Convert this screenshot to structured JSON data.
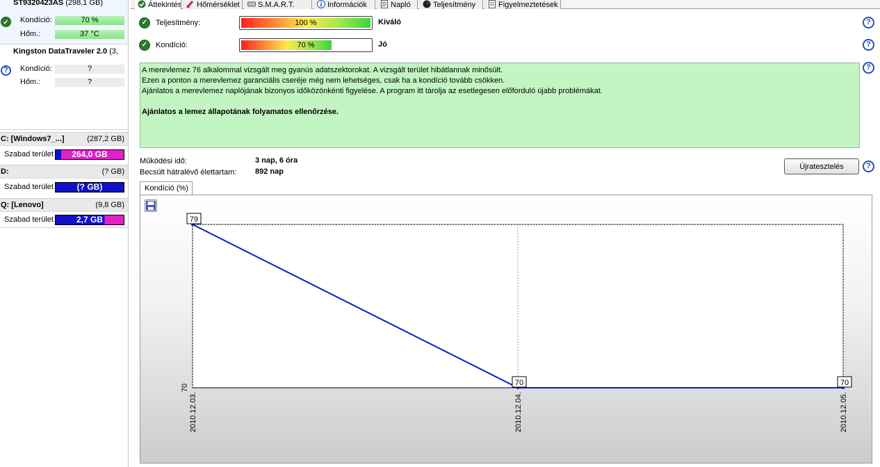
{
  "sidebar": {
    "disk1": {
      "name": "ST9320423AS",
      "size": "(298,1 GB)",
      "health_label": "Kondíció:",
      "health_value": "70 %",
      "temp_label": "Hőm.:",
      "temp_value": "37 °C"
    },
    "disk2": {
      "name": "Kingston DataTraveler 2.0",
      "size": "(3,",
      "health_label": "Kondíció:",
      "health_value": "?",
      "temp_label": "Hőm.:",
      "temp_value": "?"
    },
    "volumes": [
      {
        "name": "C: [Windows7_...]",
        "size": "(287,2 GB)",
        "free_label": "Szabad terület",
        "free_value": "264,0 GB"
      },
      {
        "name": "D:",
        "size": "(? GB)",
        "free_label": "Szabad terület",
        "free_value": "(? GB)"
      },
      {
        "name": "Q: [Lenovo]",
        "size": "(9,8 GB)",
        "free_label": "Szabad terület",
        "free_value": "2,7 GB"
      }
    ]
  },
  "tabs": [
    {
      "label": "Áttekintés",
      "icon": "check-icon"
    },
    {
      "label": "Hőmérséklet",
      "icon": "thermometer-icon"
    },
    {
      "label": "S.M.A.R.T.",
      "icon": "disk-icon"
    },
    {
      "label": "Információk",
      "icon": "info-icon"
    },
    {
      "label": "Napló",
      "icon": "log-icon"
    },
    {
      "label": "Teljesítmény",
      "icon": "gauge-icon"
    },
    {
      "label": "Figyelmeztetések",
      "icon": "warning-icon"
    }
  ],
  "overview": {
    "performance_label": "Teljesítmény:",
    "performance_value": "100 %",
    "performance_pct": 100,
    "performance_eval": "Kiváló",
    "health_label": "Kondíció:",
    "health_value": "70 %",
    "health_pct": 70,
    "health_eval": "Jó",
    "info_lines": [
      "A merevlemez 76 alkalommal vizsgált meg gyanús adatszektorokat. A vizsgált terület hibátlannak minősült.",
      "Ezen a ponton a merevlemez garanciális cseréje még nem lehetséges, csak ha a kondíció tovább csökken.",
      "Ajánlatos a merevlemez naplójának bizonyos időközönkénti figyelése. A program itt tárolja az esetlegesen előforduló újabb problémákat."
    ],
    "info_strong": "Ajánlatos a lemez állapotának folyamatos ellenőrzése.",
    "uptime_label": "Működési idő:",
    "uptime_value": "3 nap, 6 óra",
    "lifetime_label": "Becsült hátralévő élettartam:",
    "lifetime_value": "892 nap",
    "retest_label": "Újratesztelés",
    "chart_tab_label": "Kondíció (%)"
  },
  "colors": {
    "series": "#0a1ec8",
    "volume_bar": "#1010c8",
    "volume_used": "#e020c8"
  },
  "chart_data": {
    "type": "line",
    "x": [
      "2010.12.03.",
      "2010.12.04.",
      "2010.12.05."
    ],
    "series": [
      {
        "values": [
          79,
          70,
          70
        ]
      }
    ],
    "ytick_labels": [
      "70"
    ],
    "ylim": [
      70,
      79
    ],
    "grid": true
  }
}
